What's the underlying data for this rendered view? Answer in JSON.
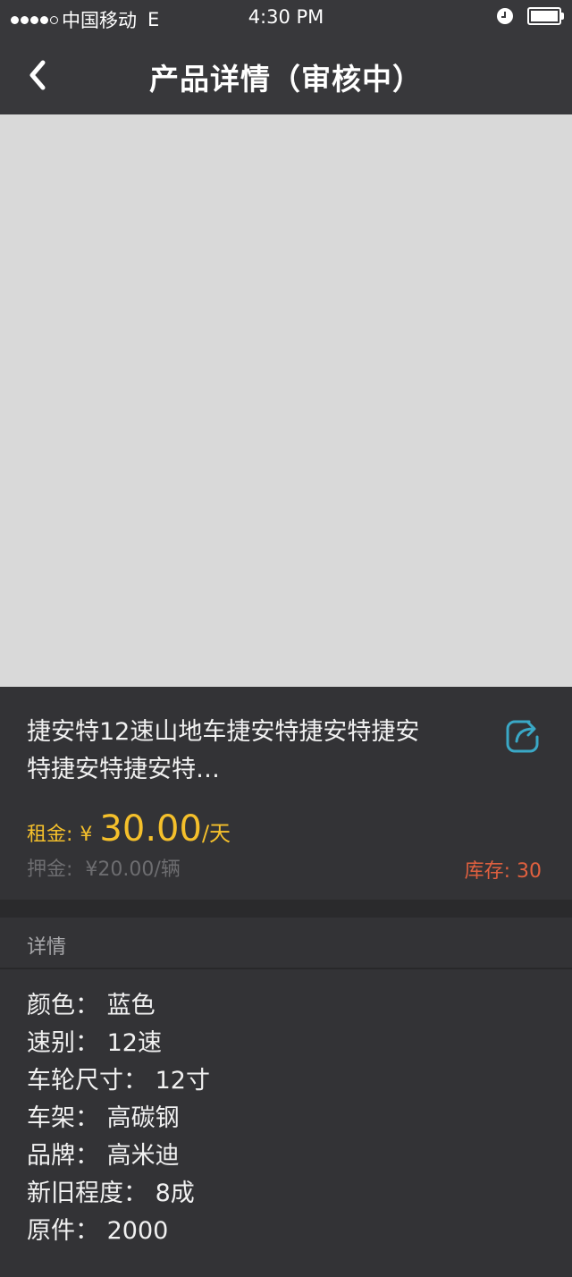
{
  "status_bar": {
    "carrier": "中国移动",
    "network": "E",
    "time": "4:30 PM"
  },
  "nav": {
    "title": "产品详情（审核中）"
  },
  "product": {
    "name_line1": "捷安特12速山地车捷安特捷安特捷安",
    "name_line2": "特捷安特捷安特…",
    "rent_label": "租金:",
    "rent_yen": "¥",
    "rent_amount": "30.00",
    "rent_unit": "/天",
    "deposit_label": "押金:",
    "deposit_value": "¥20.00/辆",
    "stock": "库存: 30"
  },
  "details": {
    "header": "详情",
    "items": [
      "颜色：  蓝色",
      "速别：  12速",
      "车轮尺寸：  12寸",
      "车架：  高碳钢",
      "品牌：  高米迪",
      "新旧程度：  8成",
      "原件：  2000"
    ]
  },
  "colors": {
    "accent_yellow": "#f5c02b",
    "stock_red": "#e0603f",
    "share_teal": "#3aa8c6",
    "background": "#333336",
    "nav_background": "#38383b",
    "image_placeholder": "#d9d9d9"
  },
  "icons": {
    "back": "chevron-left-icon",
    "share": "share-icon",
    "alarm": "alarm-clock-icon",
    "battery": "battery-icon"
  }
}
